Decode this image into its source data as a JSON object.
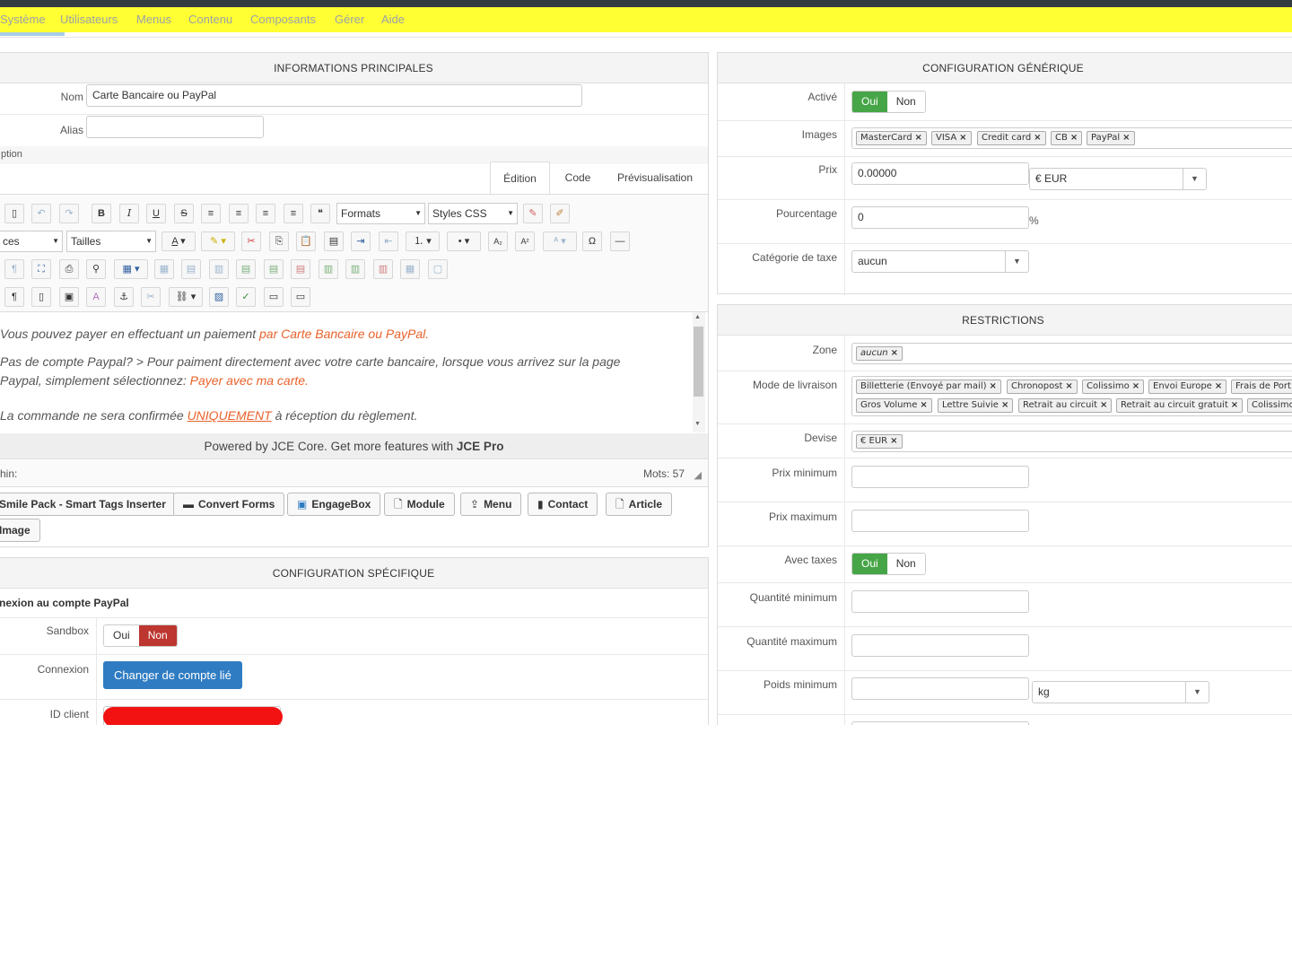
{
  "menu": [
    "Système",
    "Utilisateurs",
    "Menus",
    "Contenu",
    "Composants",
    "Gérer",
    "Aide"
  ],
  "main_info": {
    "title": "INFORMATIONS PRINCIPALES",
    "name_label": "Nom",
    "name_value": "Carte Bancaire ou PayPal",
    "alias_label": "Alias",
    "alias_value": "",
    "description_label": "ption"
  },
  "editor": {
    "tabs": [
      "Édition",
      "Code",
      "Prévisualisation"
    ],
    "formats": "Formats",
    "styles": "Styles CSS",
    "fonts": "ces",
    "sizes": "Tailles",
    "line1_a": "Vous pouvez payer en effectuant un paiement ",
    "line1_b": "par Carte Bancaire ou PayPal.",
    "line2": "Pas de compte Paypal? > Pour paiment directement avec votre carte bancaire, lorsque vous arrivez sur la page",
    "line3_a": "Paypal, simplement sélectionnez: ",
    "line3_b": "Payer avec ma carte.",
    "line4_a": "La commande ne sera confirmée ",
    "line4_b": "UNIQUEMENT",
    "line4_c": " à réception du règlement.",
    "powered_a": "Powered by JCE Core. Get more features with ",
    "powered_b": "JCE Pro",
    "path": "hin:",
    "words": "Mots: 57"
  },
  "editor_buttons": [
    "Smile Pack - Smart Tags Inserter",
    "Convert Forms",
    "EngageBox",
    "Module",
    "Menu",
    "Contact",
    "Article",
    "Image"
  ],
  "specific": {
    "title": "CONFIGURATION SPÉCIFIQUE",
    "subtitle": "nexion au compte PayPal",
    "sandbox_label": "Sandbox",
    "yes": "Oui",
    "no": "Non",
    "connexion_label": "Connexion",
    "connexion_button": "Changer de compte lié",
    "client_id_label": "ID client"
  },
  "generic": {
    "title": "CONFIGURATION GÉNÉRIQUE",
    "active_label": "Activé",
    "yes": "Oui",
    "no": "Non",
    "images_label": "Images",
    "images": [
      "MasterCard",
      "VISA",
      "Credit card",
      "CB",
      "PayPal"
    ],
    "price_label": "Prix",
    "price_value": "0.00000",
    "currency": "€ EUR",
    "percent_label": "Pourcentage",
    "percent_value": "0",
    "percent_unit": "%",
    "tax_label": "Catégorie de taxe",
    "tax_value": "aucun"
  },
  "restrictions": {
    "title": "RESTRICTIONS",
    "zone_label": "Zone",
    "zone_chip": "aucun",
    "shipping_label": "Mode de livraison",
    "shipping_row1": [
      "Billetterie (Envoyé par mail)",
      "Chronopost",
      "Colissimo",
      "Envoi Europe",
      "Frais de Port"
    ],
    "shipping_row2": [
      "Gros Volume",
      "Lettre Suivie",
      "Retrait au circuit",
      "Retrait au circuit gratuit",
      "Colissimo"
    ],
    "currency_label": "Devise",
    "currency_chip": "€ EUR",
    "min_price_label": "Prix minimum",
    "max_price_label": "Prix maximum",
    "taxes_label": "Avec taxes",
    "yes": "Oui",
    "no": "Non",
    "min_qty_label": "Quantité minimum",
    "max_qty_label": "Quantité maximum",
    "min_weight_label": "Poids minimum",
    "weight_unit": "kg"
  }
}
